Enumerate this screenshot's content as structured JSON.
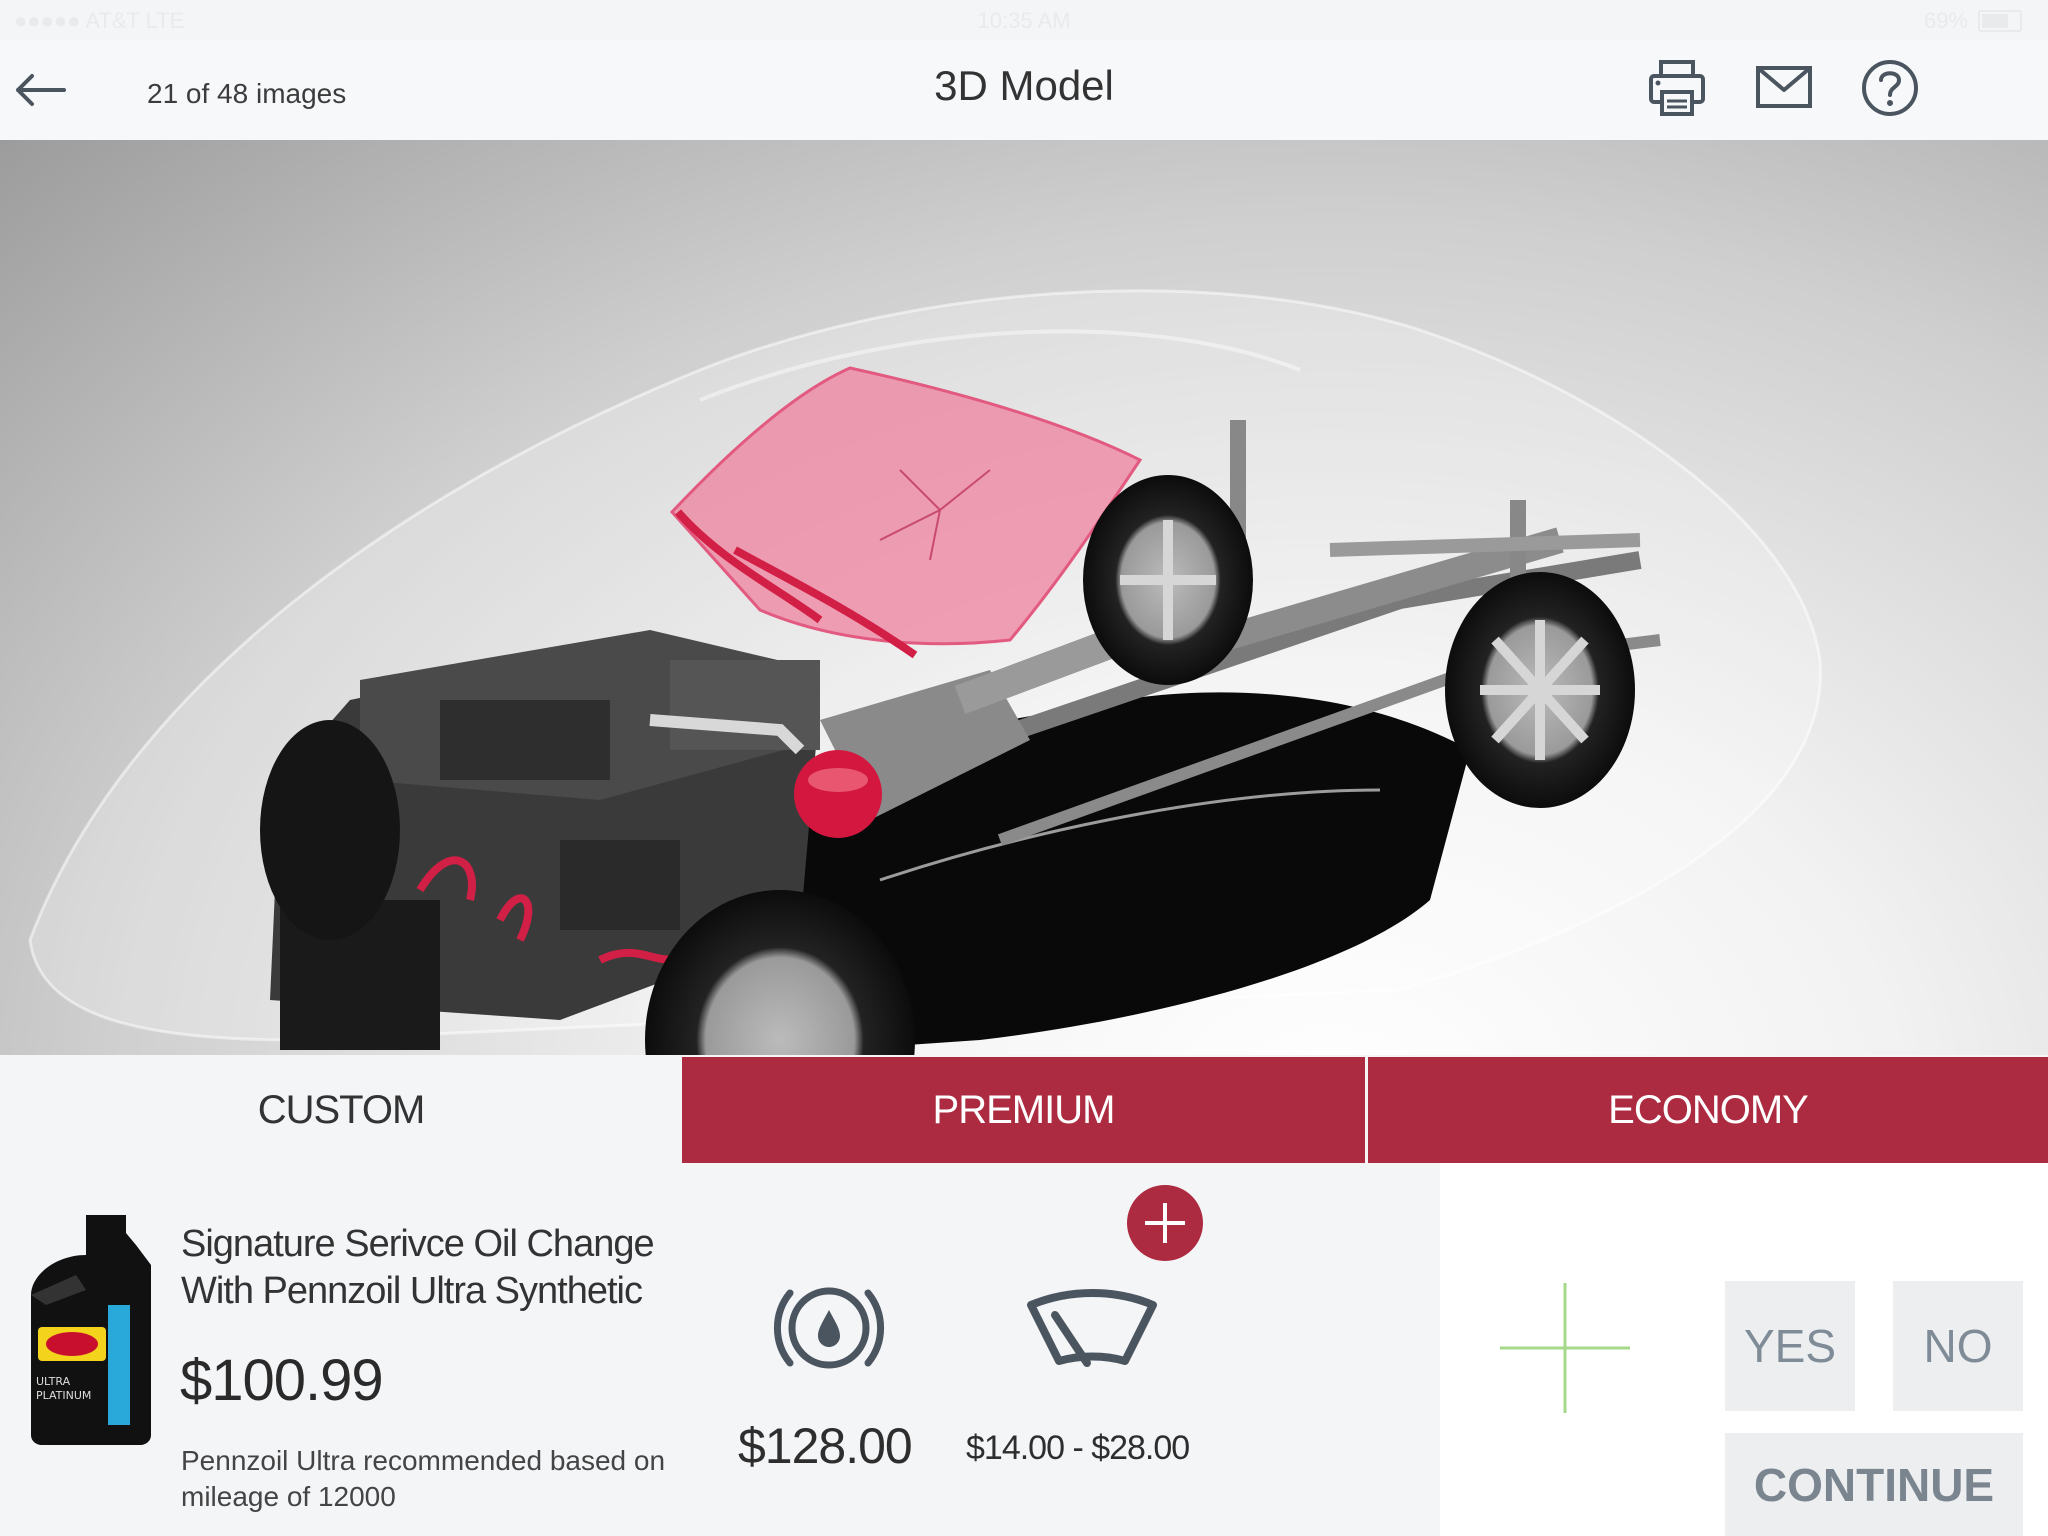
{
  "status_bar": {
    "carrier": "●●●●● AT&T  LTE",
    "time": "10:35 AM",
    "battery": "69%"
  },
  "header": {
    "image_counter": "21 of 48 images",
    "title": "3D Model"
  },
  "icons": {
    "back": "back-arrow-icon",
    "print": "printer-icon",
    "mail": "mail-icon",
    "help": "help-icon"
  },
  "tabs": [
    {
      "label": "CUSTOM",
      "selected": true
    },
    {
      "label": "PREMIUM",
      "selected": false
    },
    {
      "label": "ECONOMY",
      "selected": false
    }
  ],
  "product": {
    "name_line1": "Signature Serivce Oil Change",
    "name_line2": "With Pennzoil Ultra Synthetic",
    "price": "$100.99",
    "recommendation": "Pennzoil Ultra recommended based on mileage of 12000",
    "bottle_brand": "PENNZOIL",
    "bottle_label": "ULTRA PLATINUM"
  },
  "services": [
    {
      "icon": "oil-drop-icon",
      "price": "$128.00"
    },
    {
      "icon": "wiper-icon",
      "price": "$14.00 - $28.00"
    }
  ],
  "actions": {
    "yes": "YES",
    "no": "NO",
    "continue": "CONTINUE"
  },
  "colors": {
    "accent": "#ad2b40",
    "highlight_green": "#a5d88a",
    "icon_slate": "#4b5560"
  }
}
